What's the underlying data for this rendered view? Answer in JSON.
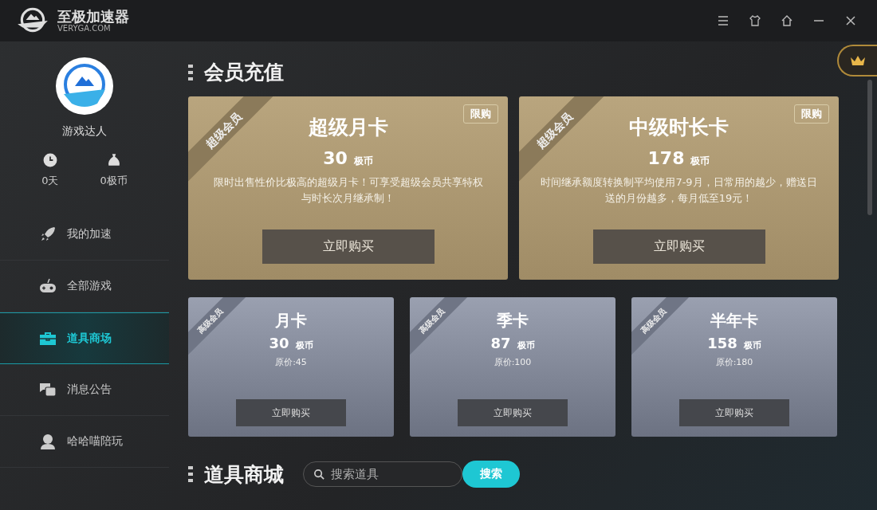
{
  "app": {
    "name": "至极加速器",
    "domain": "VERYGA.COM"
  },
  "user": {
    "name": "游戏达人",
    "days": "0天",
    "coins": "0极币"
  },
  "sidebar": {
    "items": [
      {
        "label": "我的加速",
        "selected": false
      },
      {
        "label": "全部游戏",
        "selected": false
      },
      {
        "label": "道具商场",
        "selected": true
      },
      {
        "label": "消息公告",
        "selected": false
      },
      {
        "label": "哈哈喵陪玩",
        "selected": false
      }
    ]
  },
  "membership": {
    "title": "会员充值",
    "premium_cards": [
      {
        "ribbon": "超级会员",
        "badge": "限购",
        "title": "超级月卡",
        "price": "30",
        "unit": "极币",
        "description": "限时出售性价比极高的超级月卡！可享受超级会员共享特权与时长次月继承制！",
        "button": "立即购买"
      },
      {
        "ribbon": "超级会员",
        "badge": "限购",
        "title": "中级时长卡",
        "price": "178",
        "unit": "极币",
        "description": "时间继承额度转换制平均使用7-9月，日常用的越少，赠送日送的月份越多，每月低至19元！",
        "button": "立即购买"
      }
    ],
    "cards": [
      {
        "ribbon": "高级会员",
        "title": "月卡",
        "price": "30",
        "unit": "极币",
        "original_price": "原价:45",
        "button": "立即购买"
      },
      {
        "ribbon": "高级会员",
        "title": "季卡",
        "price": "87",
        "unit": "极币",
        "original_price": "原价:100",
        "button": "立即购买"
      },
      {
        "ribbon": "高级会员",
        "title": "半年卡",
        "price": "158",
        "unit": "极币",
        "original_price": "原价:180",
        "button": "立即购买"
      }
    ]
  },
  "shop": {
    "title": "道具商城",
    "search": {
      "placeholder": "搜索道具"
    },
    "search_button": "搜索"
  }
}
